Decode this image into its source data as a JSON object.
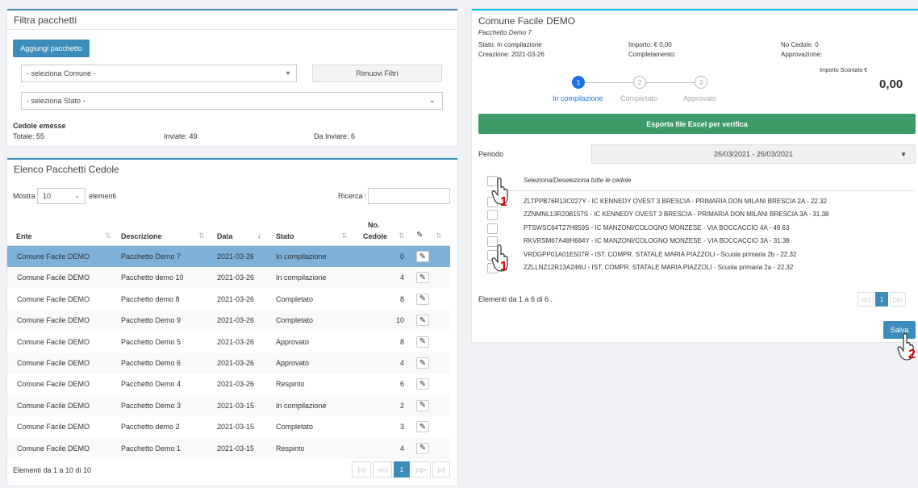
{
  "filter_panel": {
    "title": "Filtra pacchetti",
    "add_button": "Aggiungi pacchetto",
    "comune_select": "- seleziona Comune -",
    "stato_select": "- seleziona Stato -",
    "remove_filters": "Rimuovi Filtri",
    "cedole_label": "Cedole emesse",
    "totale": "Totale: 55",
    "inviate": "Inviate: 49",
    "da_inviare": "Da Inviare: 6"
  },
  "list_panel": {
    "title": "Elenco Pacchetti Cedole",
    "show_prefix": "Mostra",
    "page_size": "10",
    "show_suffix": "elementi",
    "search_label": "Ricerca :",
    "columns": {
      "ente": "Ente",
      "descrizione": "Descrizione",
      "data": "Data",
      "stato": "Stato",
      "no": "No.",
      "cedole": "Cedole"
    },
    "rows": [
      {
        "ente": "Comune Facile DEMO",
        "descrizione": "Pacchetto Demo 7",
        "data": "2021-03-26",
        "stato": "In compilazione",
        "cedole": "0"
      },
      {
        "ente": "Comune Facile DEMO",
        "descrizione": "Pacchetto demo 10",
        "data": "2021-03-26",
        "stato": "In compilazione",
        "cedole": "4"
      },
      {
        "ente": "Comune Facile DEMO",
        "descrizione": "Pacchetto demo 8",
        "data": "2021-03-26",
        "stato": "Completato",
        "cedole": "8"
      },
      {
        "ente": "Comune Facile DEMO",
        "descrizione": "Pacchetto Demo 9",
        "data": "2021-03-26",
        "stato": "Completato",
        "cedole": "10"
      },
      {
        "ente": "Comune Facile DEMO",
        "descrizione": "Pacchetto Demo 5",
        "data": "2021-03-26",
        "stato": "Approvato",
        "cedole": "8"
      },
      {
        "ente": "Comune Facile DEMO",
        "descrizione": "Pacchetto Demo 6",
        "data": "2021-03-26",
        "stato": "Approvato",
        "cedole": "4"
      },
      {
        "ente": "Comune Facile DEMO",
        "descrizione": "Pacchetto Demo 4",
        "data": "2021-03-26",
        "stato": "Respinto",
        "cedole": "6"
      },
      {
        "ente": "Comune Facile DEMO",
        "descrizione": "Pacchetto Demo 3",
        "data": "2021-03-15",
        "stato": "In compilazione",
        "cedole": "2"
      },
      {
        "ente": "Comune Facile DEMO",
        "descrizione": "Pacchetto demo 2",
        "data": "2021-03-15",
        "stato": "Completato",
        "cedole": "3"
      },
      {
        "ente": "Comune Facile DEMO",
        "descrizione": "Pacchetto Demo 1",
        "data": "2021-03-15",
        "stato": "Respinto",
        "cedole": "4"
      }
    ],
    "footer": "Elementi da 1 a 10 di 10",
    "pager": {
      "first": "|◁",
      "prev": "◁◁",
      "current": "1",
      "next": "▷▷",
      "last": "▷|"
    }
  },
  "detail_panel": {
    "title": "Comune Facile DEMO",
    "subtitle": "Pacchetto Demo 7",
    "stato": "Stato: In compilazione",
    "creazione": "Creazione: 2021-03-26",
    "importo": "Importo: € 0,00",
    "completamento": "Completamento:",
    "no_cedole": "No Cedole: 0",
    "approvazione": "Approvazione:",
    "importo_scontato_label": "Importo Scontato €",
    "importo_scontato": "0,00",
    "steps": [
      {
        "num": "1",
        "label": "In compilazione"
      },
      {
        "num": "2",
        "label": "Completato"
      },
      {
        "num": "3",
        "label": "Approvato"
      }
    ],
    "export_button": "Esporta file Excel per verifica",
    "periodo_label": "Periodo",
    "periodo_value": "26/03/2021 - 26/03/2021",
    "select_all": "Seleziona/Deseleziona tutte le cedole",
    "cedole": [
      "ZLTPPB76R13C027Y - IC KENNEDY OVEST 3 BRESCIA - PRIMARIA DON MILANI BRESCIA 2A - 22.32",
      "ZZNMNL13R20B157S - IC KENNEDY OVEST 3 BRESCIA - PRIMARIA DON MILANI BRESCIA 3A - 31.38",
      "PTSWSC64T27H859S - IC MANZONI/COLOGNO MONZESE - VIA BOCCACCIO 4A - 49.63",
      "RKVRSM67A48H684Y - IC MANZONI/COLOGNO MONZESE - VIA BOCCACCIO 3A - 31.38",
      "VRDGPP01A01E507R - IST. COMPR. STATALE MARIA PIAZZOLI - Scuola primaria 2b - 22.32",
      "ZZLLNZ12R13A246U - IST. COMPR. STATALE MARIA PIAZZOLI - Scuola primaria 2a - 22.32"
    ],
    "footer": "Elementi da 1 a 6 di 6 .",
    "pager": {
      "prev": "◁◁",
      "current": "1",
      "next": "▷▷"
    },
    "save_button": "Salva"
  },
  "annotations": {
    "step1": "1",
    "step2": "2"
  }
}
